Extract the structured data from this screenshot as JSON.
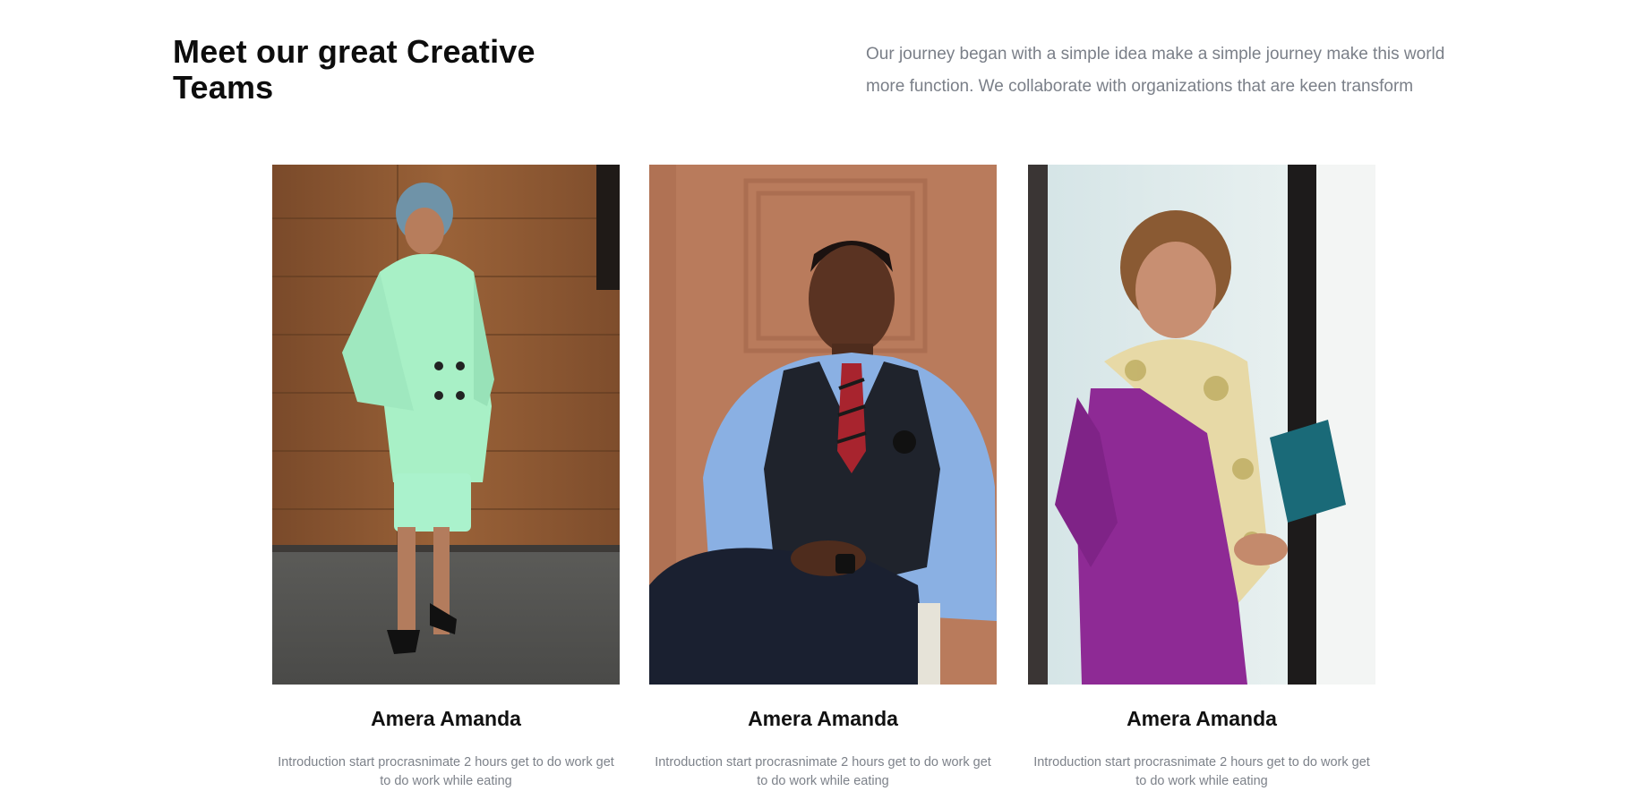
{
  "header": {
    "title": "Meet our great Creative Teams",
    "intro": "Our journey began with a simple idea make a simple journey make this world more function. We collaborate with organizations that are keen transform"
  },
  "team": [
    {
      "name": "Amera Amanda",
      "description": "Introduction start procrasnimate 2 hours get to do work get to do work while eating",
      "photo": "woman-mint-suit-portrait"
    },
    {
      "name": "Amera Amanda",
      "description": "Introduction start procrasnimate 2 hours get to do work get to do work while eating",
      "photo": "man-vest-seated-portrait"
    },
    {
      "name": "Amera Amanda",
      "description": "Introduction start procrasnimate 2 hours get to do work get to do work while eating",
      "photo": "woman-purple-dress-portrait"
    }
  ]
}
